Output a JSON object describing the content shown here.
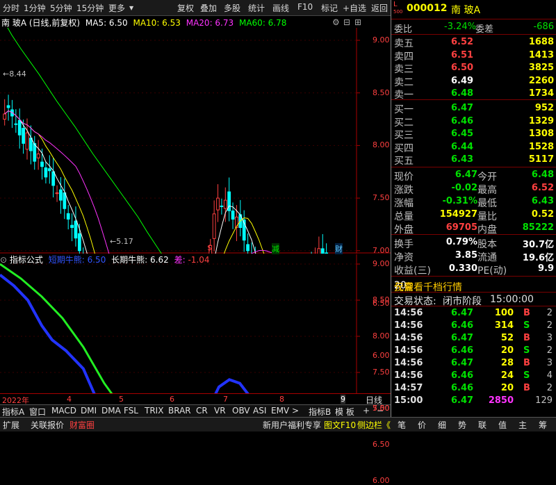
{
  "toolbar": {
    "items": [
      "分时",
      "1分钟",
      "5分钟",
      "15分钟",
      "更多",
      "复权",
      "叠加",
      "多股",
      "统计",
      "画线",
      "F10",
      "标记",
      "+自选",
      "返回"
    ]
  },
  "header": {
    "name": "南 玻A",
    "mode": "(日线,前复权)",
    "ma5": "MA5: 6.50",
    "ma10": "MA10: 6.53",
    "ma20": "MA20: 6.73",
    "ma60": "MA60: 6.78"
  },
  "colors": {
    "ma5": "#ffffff",
    "ma10": "#ffff00",
    "ma20": "#ff33ff",
    "ma60": "#00ff00",
    "up": "#ff4040",
    "down": "#00ffff"
  },
  "price_axis": [
    "9.00",
    "8.50",
    "8.00",
    "7.50",
    "7.00",
    "6.50",
    "6.00",
    "5.50"
  ],
  "annotations": {
    "high": "8.44",
    "low": "5.17"
  },
  "event_marks": [
    "$",
    "减",
    "财"
  ],
  "indicator": {
    "title": "指标公式",
    "short_label": "短期牛熊:",
    "short_value": "6.50",
    "long_label": "长期牛熊:",
    "long_value": "6.62",
    "diff_label": "差:",
    "diff_value": "-1.04",
    "axis": [
      "9.00",
      "8.50",
      "8.00",
      "7.50",
      "7.00",
      "6.50",
      "6.00"
    ]
  },
  "time_axis": {
    "labels": [
      "2022年",
      "4",
      "5",
      "6",
      "7",
      "8",
      "9"
    ],
    "right_label": "日线"
  },
  "tabs": [
    "指标A",
    "窗口",
    "MACD",
    "DMI",
    "DMA",
    "FSL",
    "TRIX",
    "BRAR",
    "CR",
    "VR",
    "OBV",
    "ASI",
    "EMV",
    ">",
    "指标B",
    "模 板",
    "+",
    "−"
  ],
  "bottombar": [
    "扩展",
    "关联报价",
    "财富圈",
    "新用户福利专享",
    "图文F10",
    "侧边栏《"
  ],
  "quote": {
    "badge_top": "L",
    "badge_bottom": "500",
    "code": "000012",
    "name": "南 玻A",
    "weibi_label": "委比",
    "weibi": "-3.24%",
    "weicha_label": "委差",
    "weicha": "-686",
    "sells": [
      {
        "label": "卖五",
        "price": "6.52",
        "vol": "1688"
      },
      {
        "label": "卖四",
        "price": "6.51",
        "vol": "1413"
      },
      {
        "label": "卖三",
        "price": "6.50",
        "vol": "3825"
      },
      {
        "label": "卖二",
        "price": "6.49",
        "vol": "2260"
      },
      {
        "label": "卖一",
        "price": "6.48",
        "vol": "1734"
      }
    ],
    "buys": [
      {
        "label": "买一",
        "price": "6.47",
        "vol": "952"
      },
      {
        "label": "买二",
        "price": "6.46",
        "vol": "1329"
      },
      {
        "label": "买三",
        "price": "6.45",
        "vol": "1308"
      },
      {
        "label": "买四",
        "price": "6.44",
        "vol": "1528"
      },
      {
        "label": "买五",
        "price": "6.43",
        "vol": "5117"
      }
    ],
    "stats": [
      {
        "l1": "现价",
        "v1": "6.47",
        "l2": "今开",
        "v2": "6.48"
      },
      {
        "l1": "涨跌",
        "v1": "-0.02",
        "l2": "最高",
        "v2": "6.52"
      },
      {
        "l1": "涨幅",
        "v1": "-0.31%",
        "l2": "最低",
        "v2": "6.43"
      },
      {
        "l1": "总量",
        "v1": "154927",
        "l2": "量比",
        "v2": "0.52"
      },
      {
        "l1": "外盘",
        "v1": "69705",
        "l2": "内盘",
        "v2": "85222"
      }
    ],
    "stats2": [
      {
        "l1": "换手",
        "v1": "0.79%",
        "l2": "股本",
        "v2": "30.7亿"
      },
      {
        "l1": "净资",
        "v1": "3.85",
        "l2": "流通",
        "v2": "19.6亿"
      },
      {
        "l1": "收益(三)",
        "v1": "0.330",
        "l2": "PE(动)",
        "v2": "9.9"
      }
    ],
    "promo_pre": "仅需",
    "promo_num": "20",
    "promo_post": "元查看千档行情",
    "status_label": "交易状态:",
    "status_value": "闭市阶段",
    "status_time": "15:00:00",
    "ticks": [
      {
        "t": "14:56",
        "p": "6.47",
        "v": "100",
        "s": "B",
        "n": "2"
      },
      {
        "t": "14:56",
        "p": "6.46",
        "v": "314",
        "s": "S",
        "n": "2"
      },
      {
        "t": "14:56",
        "p": "6.47",
        "v": "52",
        "s": "B",
        "n": "3"
      },
      {
        "t": "14:56",
        "p": "6.46",
        "v": "20",
        "s": "S",
        "n": "2"
      },
      {
        "t": "14:56",
        "p": "6.47",
        "v": "28",
        "s": "B",
        "n": "3"
      },
      {
        "t": "14:56",
        "p": "6.46",
        "v": "24",
        "s": "S",
        "n": "4"
      },
      {
        "t": "14:57",
        "p": "6.46",
        "v": "20",
        "s": "B",
        "n": "2"
      },
      {
        "t": "15:00",
        "p": "6.47",
        "v": "2850",
        "s": "",
        "n": "129"
      }
    ],
    "bottom_tabs": [
      "笔",
      "价",
      "细",
      "势",
      "联",
      "值",
      "主",
      "筹"
    ]
  }
}
